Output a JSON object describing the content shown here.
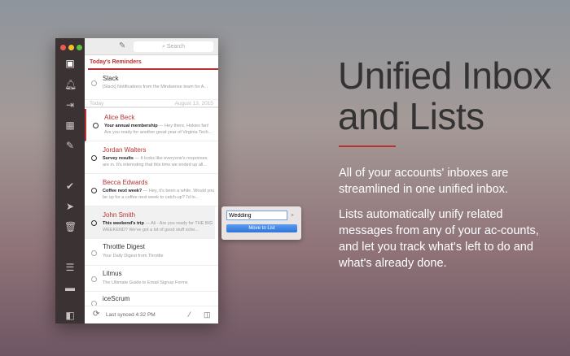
{
  "toolbar": {
    "search_placeholder": "Search"
  },
  "reminders": {
    "header": "Today's Reminders",
    "items": [
      {
        "name": "Slack",
        "snippet": "[Slack] Notifications from the Mindsense team for A..."
      }
    ]
  },
  "today": {
    "label": "Today",
    "date": "August 13, 2015"
  },
  "emails": [
    {
      "name": "Alice Beck",
      "subject": "Your annual membership",
      "preview": " — Hey there, Hokies fan! Are you ready for another great year of Virginia Tech..."
    },
    {
      "name": "Jordan Walters",
      "subject": "Survey results",
      "preview": " — It looks like everyone's responses are in. It's interesting that this time we ended up all..."
    },
    {
      "name": "Becca Edwards",
      "subject": "Coffee next week?",
      "preview": " — Hey, it's been a while. Would you be up for a coffee next week to catch-up? I'd lo..."
    },
    {
      "name": "John Smith",
      "subject": "This weekend's trip",
      "preview": " — Ali - Are you ready for THE BIG WEEKEND? We've got a lot of good stuff sche..."
    }
  ],
  "lists": [
    {
      "name": "Throttle Digest",
      "snippet": "Your Daily Digest from Throttle"
    },
    {
      "name": "Litmus",
      "snippet": "The Ultimate Guide to Email Signup Forms"
    },
    {
      "name": "iceScrum",
      "snippet": ""
    }
  ],
  "footer": {
    "status": "Last synced 4:32 PM"
  },
  "popover": {
    "value": "Wedding",
    "button": "Move to List"
  },
  "hero": {
    "title_line1": "Unified Inbox",
    "title_line2": "and Lists",
    "p1": "All of your accounts' inboxes are streamlined in one unified inbox.",
    "p2": "Lists automatically unify related messages from any of your ac-counts, and let you track what's left to do and what's already done."
  },
  "colors": {
    "accent": "#b8312f",
    "sidebar": "#3a3233"
  }
}
